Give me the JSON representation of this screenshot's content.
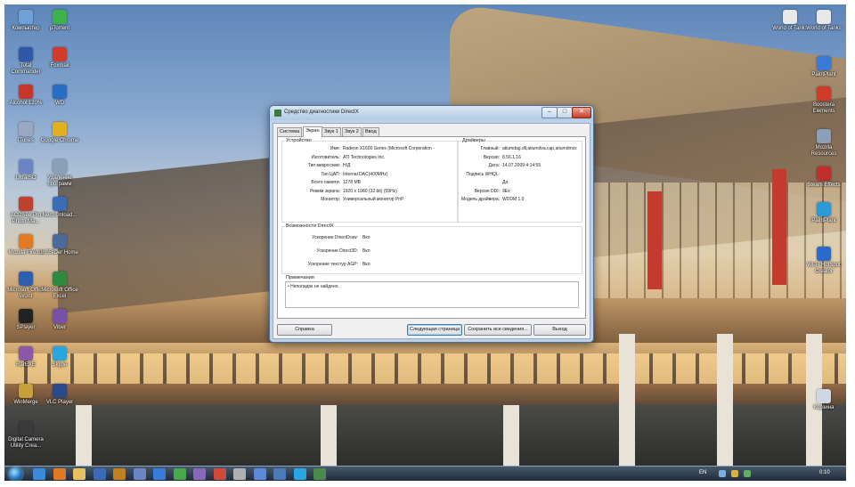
{
  "desktop": {
    "icons_left": [
      {
        "label": "Компьютер",
        "color": "#6fa0d8"
      },
      {
        "label": "µTorrent",
        "color": "#3db24a"
      },
      {
        "label": "Total Commander",
        "color": "#2e58a8"
      },
      {
        "label": "Foxmail",
        "color": "#d23a2a"
      },
      {
        "label": "Alcohol 120%",
        "color": "#c8352b"
      },
      {
        "label": "WD",
        "color": "#2a6ec4"
      },
      {
        "label": "iTunes",
        "color": "#9aa7c2"
      },
      {
        "label": "Google Chrome",
        "color": "#e0b020"
      },
      {
        "label": "UltraISO",
        "color": "#6a84c4"
      },
      {
        "label": "Удаление программ",
        "color": "#8aa0b8"
      },
      {
        "label": "ACDSee Pro Photo Ma...",
        "color": "#c04030"
      },
      {
        "label": "Nero Unload...",
        "color": "#3a6db5"
      },
      {
        "label": "Mozilla Firefox",
        "color": "#e27a22"
      },
      {
        "label": "inSSIDer Home",
        "color": "#4a6a98"
      },
      {
        "label": "Microsoft Office Word",
        "color": "#2b5fb0"
      },
      {
        "label": "Microsoft Office Excel",
        "color": "#2e8a3e"
      },
      {
        "label": "SPlayer",
        "color": "#222222"
      },
      {
        "label": "Viber",
        "color": "#7a4fa8"
      },
      {
        "label": "RarEXE",
        "color": "#8a5aa8"
      },
      {
        "label": "Skype",
        "color": "#29a6e0"
      },
      {
        "label": "WinMerge",
        "color": "#c8a03a"
      },
      {
        "label": "VLC Player",
        "color": "#2a4a8a"
      },
      {
        "label": "Digital Camera Utility Crea...",
        "color": "#3a3a3a"
      }
    ],
    "icons_right": [
      {
        "label": "World of Tanks",
        "color": "#e8e8e8"
      },
      {
        "label": "World of Tanks",
        "color": "#e8e8e8"
      },
      {
        "label": "PaintPlant",
        "color": "#3a7ad8"
      },
      {
        "label": "Boostera Elements",
        "color": "#d03a2a"
      },
      {
        "label": "Mozilla Resources",
        "color": "#8aa0b8"
      },
      {
        "label": "Steam Effects",
        "color": "#c0302a"
      },
      {
        "label": "PaintPlant",
        "color": "#2a9ad8"
      },
      {
        "label": "Wi-Fi HotSpot Creator",
        "color": "#2a6ac8"
      },
      {
        "label": "Корзина",
        "color": "#cfd8e2"
      }
    ]
  },
  "window": {
    "title": "Средство диагностики DirectX",
    "controls": {
      "minimize": "–",
      "maximize": "□",
      "close": "✕"
    },
    "tabs": [
      "Система",
      "Экран",
      "Звук 1",
      "Звук 2",
      "Ввод"
    ],
    "active_tab": "Экран",
    "device": {
      "title": "Устройство",
      "rows": [
        {
          "label": "Имя:",
          "value": "Radeon X1600 Series (Microsoft Corporation -"
        },
        {
          "label": "Изготовитель:",
          "value": "ATI Technologies Inc."
        },
        {
          "label": "Тип микросхем:",
          "value": "Н/Д"
        },
        {
          "label": "Тип ЦАП:",
          "value": "Internal DAC(400MHz)"
        },
        {
          "label": "Всего памяти:",
          "value": "1278 MB"
        },
        {
          "label": "Режим экрана:",
          "value": "1920 x 1080 (32 bit) (59Hz)"
        },
        {
          "label": "Монитор:",
          "value": "Универсальный монитор PnP"
        }
      ]
    },
    "drivers": {
      "title": "Драйверы",
      "rows": [
        {
          "label": "Главный:",
          "value": "atiumdag.dll,atiumdva.cap,atiumdmxx"
        },
        {
          "label": "Версия:",
          "value": "8.56.1.16"
        },
        {
          "label": "Дата:",
          "value": "14.07.2009 4:14:55"
        },
        {
          "label": "Подпись WHQL:",
          "value": ""
        },
        {
          "label": "",
          "value": "Да"
        },
        {
          "label": "Версия DDI:",
          "value": "9Ex"
        },
        {
          "label": "Модель драйвера:",
          "value": "WDDM 1.0"
        }
      ]
    },
    "features": {
      "title": "Возможности DirectX",
      "rows": [
        {
          "label": "Ускорение DirectDraw:",
          "value": "Вкл"
        },
        {
          "label": "Ускорение Direct3D:",
          "value": "Вкл"
        },
        {
          "label": "Ускорение текстур AGP:",
          "value": "Вкл"
        }
      ]
    },
    "notes": {
      "title": "Примечания",
      "items": [
        "Неполадок не найдено."
      ]
    },
    "buttons": {
      "help": "Справка",
      "next": "Следующая страница",
      "save": "Сохранить все сведения...",
      "exit": "Выход"
    }
  },
  "taskbar": {
    "apps": [
      {
        "name": "ie",
        "color": "#3a8ad8"
      },
      {
        "name": "firefox",
        "color": "#e07a22"
      },
      {
        "name": "explorer",
        "color": "#e8c060"
      },
      {
        "name": "media",
        "color": "#3a6ab8"
      },
      {
        "name": "app5",
        "color": "#c08020"
      },
      {
        "name": "app6",
        "color": "#6a84c4"
      },
      {
        "name": "app7",
        "color": "#3a7ad8"
      },
      {
        "name": "app8",
        "color": "#4aa84a"
      },
      {
        "name": "app9",
        "color": "#8a6ab8"
      },
      {
        "name": "app10",
        "color": "#d04a3a"
      },
      {
        "name": "app11",
        "color": "#b0b0b0"
      },
      {
        "name": "app12",
        "color": "#5a8ad8"
      },
      {
        "name": "app13",
        "color": "#4a7ab8"
      },
      {
        "name": "app14",
        "color": "#29a6e0"
      },
      {
        "name": "dxdiag",
        "color": "#4a8a4a"
      }
    ],
    "language": "EN",
    "clock": "0:10"
  }
}
